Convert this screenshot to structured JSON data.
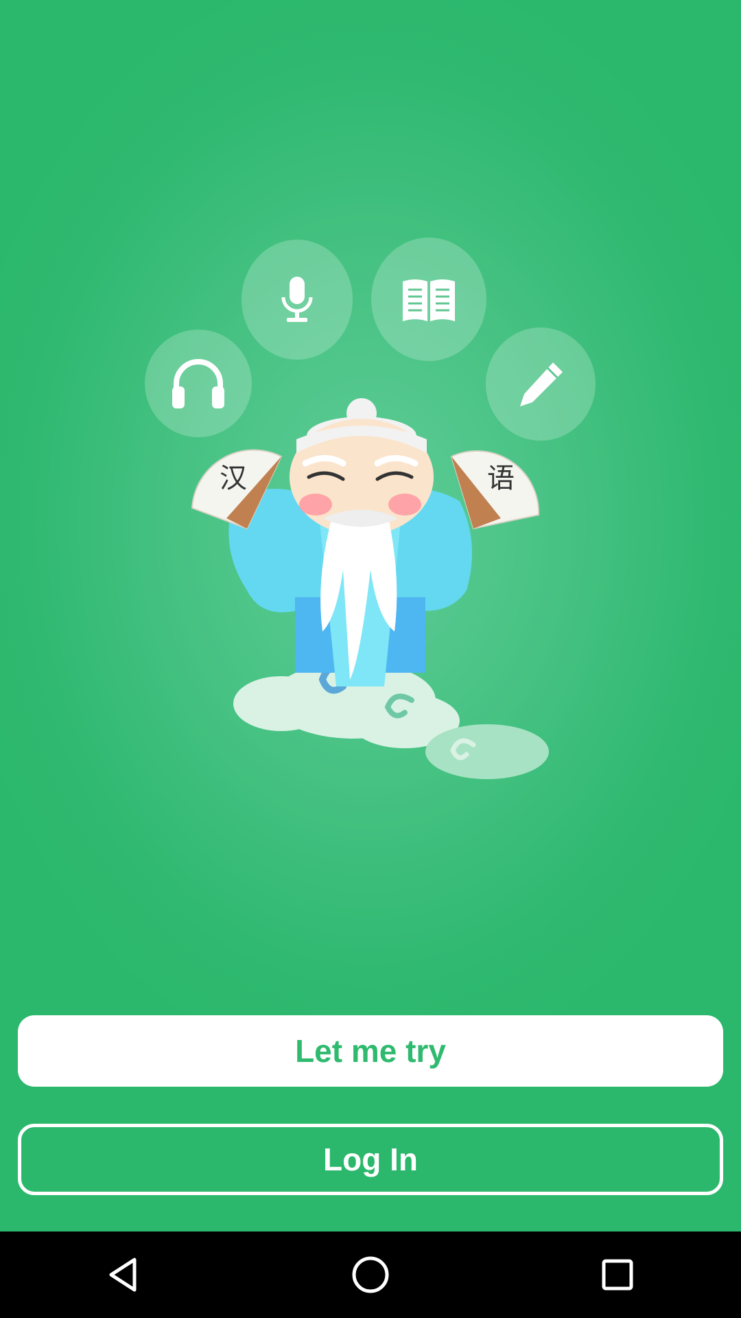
{
  "skills": [
    {
      "name": "listening",
      "icon": "headphones-icon"
    },
    {
      "name": "speaking",
      "icon": "microphone-icon"
    },
    {
      "name": "reading",
      "icon": "book-icon"
    },
    {
      "name": "writing",
      "icon": "pen-icon"
    }
  ],
  "mascot": {
    "left_fan": "汉",
    "right_fan": "语"
  },
  "buttons": {
    "try_label": "Let me try",
    "login_label": "Log In"
  },
  "colors": {
    "brand_green": "#2fba6f",
    "white": "#ffffff"
  },
  "navbar": {
    "back_icon": "back-triangle-icon",
    "home_icon": "home-circle-icon",
    "recents_icon": "recents-square-icon"
  }
}
